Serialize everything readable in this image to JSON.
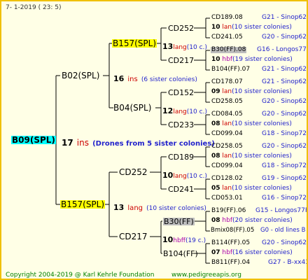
{
  "header": {
    "date": "7-  1-2019  ( 23:  5)"
  },
  "root": {
    "id": "B09(SPL)",
    "count": "17",
    "unit": "ins",
    "note": "(Drones from 5 sister colonies)"
  },
  "gen1": [
    {
      "id": "B02(SPL)",
      "count": "16",
      "unit": "ins",
      "note": "(6 sister colonies)"
    },
    {
      "id": "B157(SPL)",
      "count": "13",
      "unit": "lang",
      "note": "(10 sister colonies)"
    }
  ],
  "gen2": [
    {
      "id": "B157(SPL)",
      "count": "13",
      "unit": "lang",
      "note": "(10 c.)"
    },
    {
      "id": "B04(SPL)",
      "count": "12",
      "unit": "lang",
      "note": "(10 c.)"
    },
    {
      "id": "CD252",
      "count": "10",
      "unit": "lang",
      "note": "(10 c.)"
    },
    {
      "id": "CD217",
      "count": "10",
      "unit": "hbff",
      "note": "(19 c.)"
    }
  ],
  "gen3": [
    {
      "id": "CD252"
    },
    {
      "id": "CD217"
    },
    {
      "id": "CD152"
    },
    {
      "id": "CD233"
    },
    {
      "id": "CD189"
    },
    {
      "id": "CD241"
    },
    {
      "id": "B30(FF)"
    },
    {
      "id": "B104(FF)"
    }
  ],
  "gen4": [
    {
      "top": "CD189.08",
      "top_r": "G21 - Sinop62R",
      "num": "10",
      "unit": "lan",
      "note": "(10 sister colonies)",
      "bot": "CD241.05",
      "bot_r": "G20 - Sinop62R"
    },
    {
      "top": "B30(FF).08",
      "top_r": "G16 - Longos77R",
      "num": "10",
      "unit": "hbf",
      "note": "(19 sister colonies)",
      "bot": "B104(FF).07",
      "bot_r": "G21 - Sinop62R"
    },
    {
      "top": "CD178.07",
      "top_r": "G21 - Sinop62R",
      "num": "09",
      "unit": "lan",
      "note": "(10 sister colonies)",
      "bot": "CD258.05",
      "bot_r": "G20 - Sinop62R"
    },
    {
      "top": "CD084.05",
      "top_r": "G20 - Sinop62R",
      "num": "08",
      "unit": "lan",
      "note": "(10 sister colonies)",
      "bot": "CD099.04",
      "bot_r": "G18 - Sinop72R"
    },
    {
      "top": "CD258.05",
      "top_r": "G20 - Sinop62R",
      "num": "08",
      "unit": "lan",
      "note": "(10 sister colonies)",
      "bot": "CD099.04",
      "bot_r": "G18 - Sinop72R"
    },
    {
      "top": "CD128.02",
      "top_r": "G19 - Sinop62R",
      "num": "05",
      "unit": "lan",
      "note": "(10 sister colonies)",
      "bot": "CD053.01",
      "bot_r": "G16 - Sinop72R"
    },
    {
      "top": "B19(FF).06",
      "top_r": "G15 - Longos77R",
      "num": "08",
      "unit": "hbf",
      "note": "(20 sister colonies)",
      "bot": "Bmix08(FF).05",
      "bot_r": "G0 - old lines B"
    },
    {
      "top": "B114(FF).05",
      "top_r": "G20 - Sinop62R",
      "num": "07",
      "unit": "hbf",
      "note": "(16 sister colonies)",
      "bot": "B811(FF).04",
      "bot_r": "G27 - B-xx43"
    }
  ],
  "footer": {
    "copyright": "Copyright 2004-2019 @ Karl Kehrle Foundation",
    "site": "www.pedigreeapis.org"
  },
  "colors": {
    "frame": "#f0c000",
    "background": "#ffffe6",
    "highlight": "#ffff00",
    "root_highlight": "#00ffff",
    "gray_highlight": "#bdbdbd",
    "unit_text": "#cc0000",
    "note_text": "#2222cc",
    "footer_text": "#008000"
  }
}
